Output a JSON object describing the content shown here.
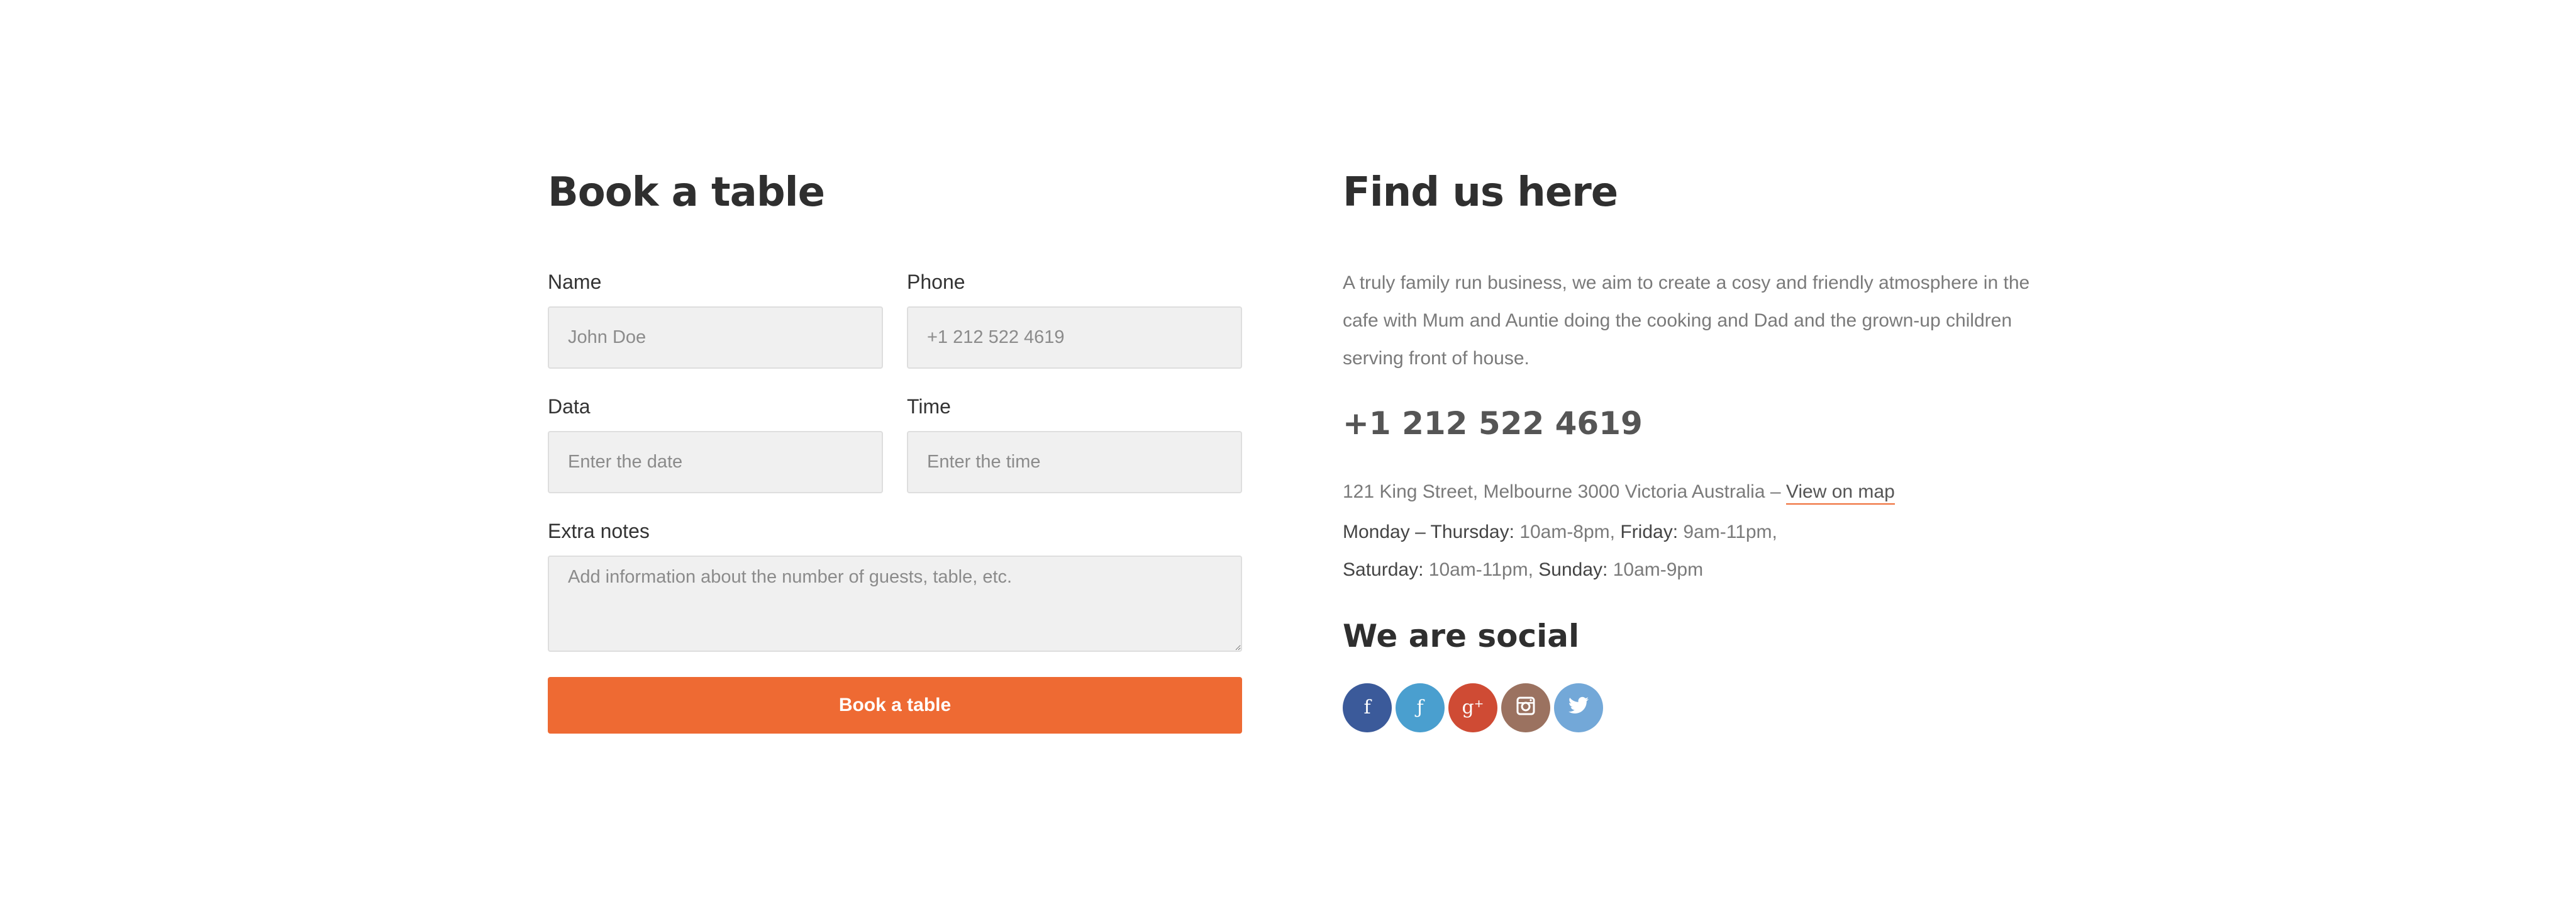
{
  "booking": {
    "title": "Book a table",
    "fields": {
      "name": {
        "label": "Name",
        "placeholder": "John Doe"
      },
      "phone": {
        "label": "Phone",
        "placeholder": "+1 212 522 4619"
      },
      "date": {
        "label": "Data",
        "placeholder": "Enter the date"
      },
      "time": {
        "label": "Time",
        "placeholder": "Enter the time"
      },
      "notes": {
        "label": "Extra notes",
        "placeholder": "Add information about the number of guests, table, etc."
      }
    },
    "submit_label": "Book a table",
    "accent_color": "#ee6a33"
  },
  "find_us": {
    "title": "Find us here",
    "description": "A truly family run business, we aim to create a cosy and friendly atmosphere in the cafe with Mum and Auntie doing the cooking and Dad and the grown-up children serving front of house.",
    "phone": "+1 212 522 4619",
    "address": "121 King Street, Melbourne 3000 Victoria Australia – ",
    "map_link": "View on map",
    "hours": {
      "mon_thu_label": "Monday – Thursday:",
      "mon_thu_value": " 10am-8pm, ",
      "fri_label": "Friday:",
      "fri_value": " 9am-11pm,",
      "sat_label": "Saturday:",
      "sat_value": " 10am-11pm, ",
      "sun_label": "Sunday:",
      "sun_value": " 10am-9pm"
    }
  },
  "social": {
    "title": "We are social",
    "links": [
      {
        "icon": "facebook-icon",
        "glyph": "f",
        "color": "#3b5a9a"
      },
      {
        "icon": "foursquare-icon",
        "glyph": "ƒ",
        "color": "#4a9fcf"
      },
      {
        "icon": "google-plus-icon",
        "glyph": "g⁺",
        "color": "#cf4b34"
      },
      {
        "icon": "instagram-icon",
        "glyph": "◙",
        "color": "#9b7260"
      },
      {
        "icon": "twitter-icon",
        "glyph": "🐦",
        "color": "#73a8d8"
      }
    ]
  }
}
